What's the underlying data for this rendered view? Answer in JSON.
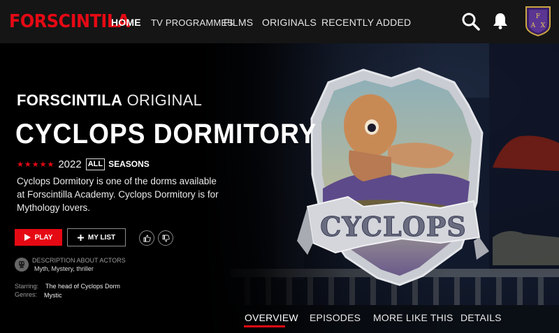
{
  "brand": {
    "name": "FORSCINTILA",
    "color": "#e50914"
  },
  "nav": {
    "items": [
      {
        "label": "HOME",
        "active": true
      },
      {
        "label": "TV PROGRAMMES",
        "active": false
      },
      {
        "label": "FILMS",
        "active": false
      },
      {
        "label": "ORIGINALS",
        "active": false
      },
      {
        "label": "RECENTLY ADDED",
        "active": false
      }
    ],
    "icons": [
      "search-icon",
      "bell-icon"
    ],
    "avatar_letters": "FAX"
  },
  "hero": {
    "original_prefix": "FORSCINTILA",
    "original_suffix": "ORIGINAL",
    "title": "CYCLOPS DORMITORY",
    "stars": "★★★★★",
    "year": "2022",
    "rating": "ALL",
    "seasons": "SEASONS",
    "description": "Cyclops Dormitory is one of the dorms available at Forscintilla Academy. Cyclops Dormitory is for Mythology lovers.",
    "crest_text": "CYCLOPS"
  },
  "actions": {
    "play_label": "PLAY",
    "mylist_label": "MY LIST"
  },
  "details": {
    "actors_title": "DESCRIPTION ABOUT ACTORS",
    "actors_tags": "Myth, Mystery, thriller",
    "starring_label": "Starring:",
    "starring_value": "The head of Cyclops Dorm",
    "genres_label": "Genres:",
    "genres_value": "Mystic"
  },
  "tabs": [
    {
      "label": "OVERVIEW",
      "active": true
    },
    {
      "label": "EPISODES",
      "active": false
    },
    {
      "label": "MORE LIKE THIS",
      "active": false
    },
    {
      "label": "DETAILS",
      "active": false
    }
  ],
  "colors": {
    "accent": "#e50914",
    "nav_bg": "#151515",
    "background": "#000000"
  }
}
